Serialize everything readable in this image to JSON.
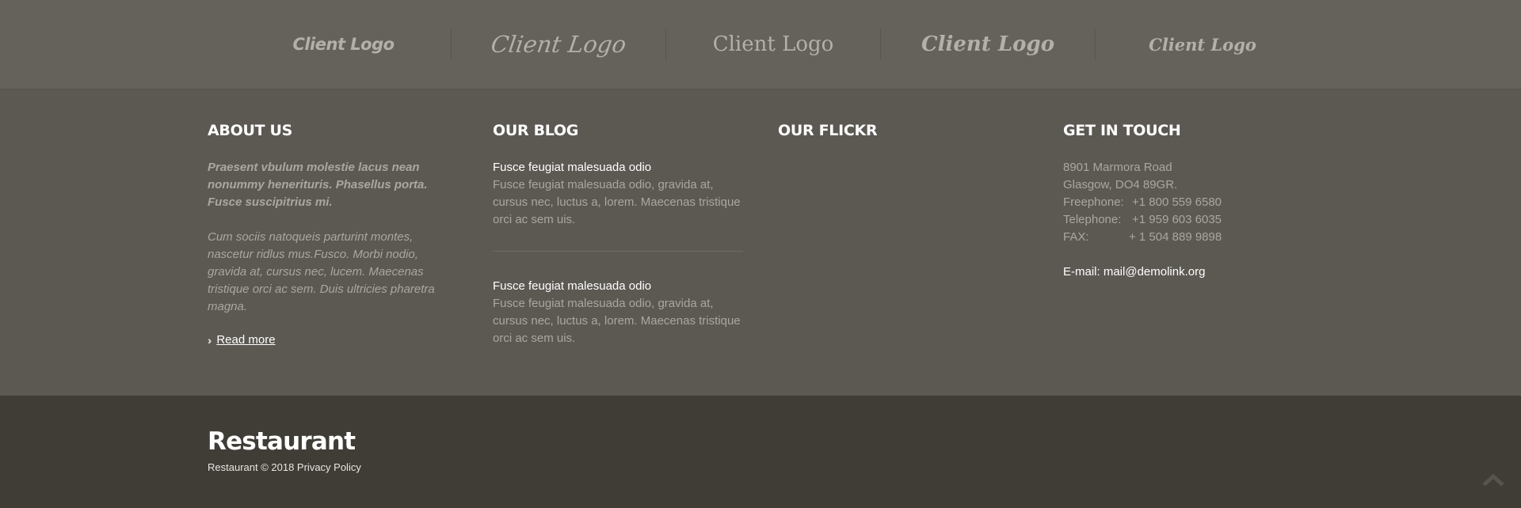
{
  "client_logos": [
    "Client Logo",
    "Client Logo",
    "Client Logo",
    "Client Logo",
    "Client Logo"
  ],
  "about": {
    "heading": "ABOUT US",
    "lead": "Praesent vbulum molestie lacus nean nonummy henerituris. Phasellus porta. Fusce suscipitrius mi.",
    "body": "Cum sociis natoqueis parturint montes, nascetur ridlus mus.Fusco. Morbi nodio, gravida at, cursus nec, lucem. Maecenas tristique orci ac sem. Duis ultricies pharetra magna.",
    "read_more": "Read more"
  },
  "blog": {
    "heading": "OUR BLOG",
    "posts": [
      {
        "title": "Fusce feugiat malesuada odio",
        "text": "Fusce feugiat malesuada odio, gravida at, cursus nec, luctus a, lorem. Maecenas tristique orci ac sem uis."
      },
      {
        "title": "Fusce feugiat malesuada odio",
        "text": "Fusce feugiat malesuada odio, gravida at, cursus nec, luctus a, lorem. Maecenas tristique orci ac sem uis."
      }
    ]
  },
  "flickr": {
    "heading": "OUR FLICKR"
  },
  "contact": {
    "heading": "GET IN TOUCH",
    "address_line1": "8901 Marmora Road",
    "address_line2": "Glasgow, DO4 89GR.",
    "freephone_label": "Freephone:",
    "freephone": "+1 800 559 6580",
    "telephone_label": "Telephone:",
    "telephone": "+1 959 603 6035",
    "fax_label": "FAX:",
    "fax": "+ 1 504 889 9898",
    "email_label": "E-mail:",
    "email": "mail@demolink.org"
  },
  "footer": {
    "brand": "Restaurant",
    "copyright": "Restaurant © 2018 Privacy Policy"
  },
  "colors": {
    "logos_bar": "#65625b",
    "main_bg": "#5c5953",
    "bottom_bg": "#403c36",
    "muted_text": "#aaa6a0",
    "white": "#ffffff"
  },
  "icons": {
    "read_more": "double-chevron-right-icon",
    "scroll_top": "chevron-up-icon"
  }
}
